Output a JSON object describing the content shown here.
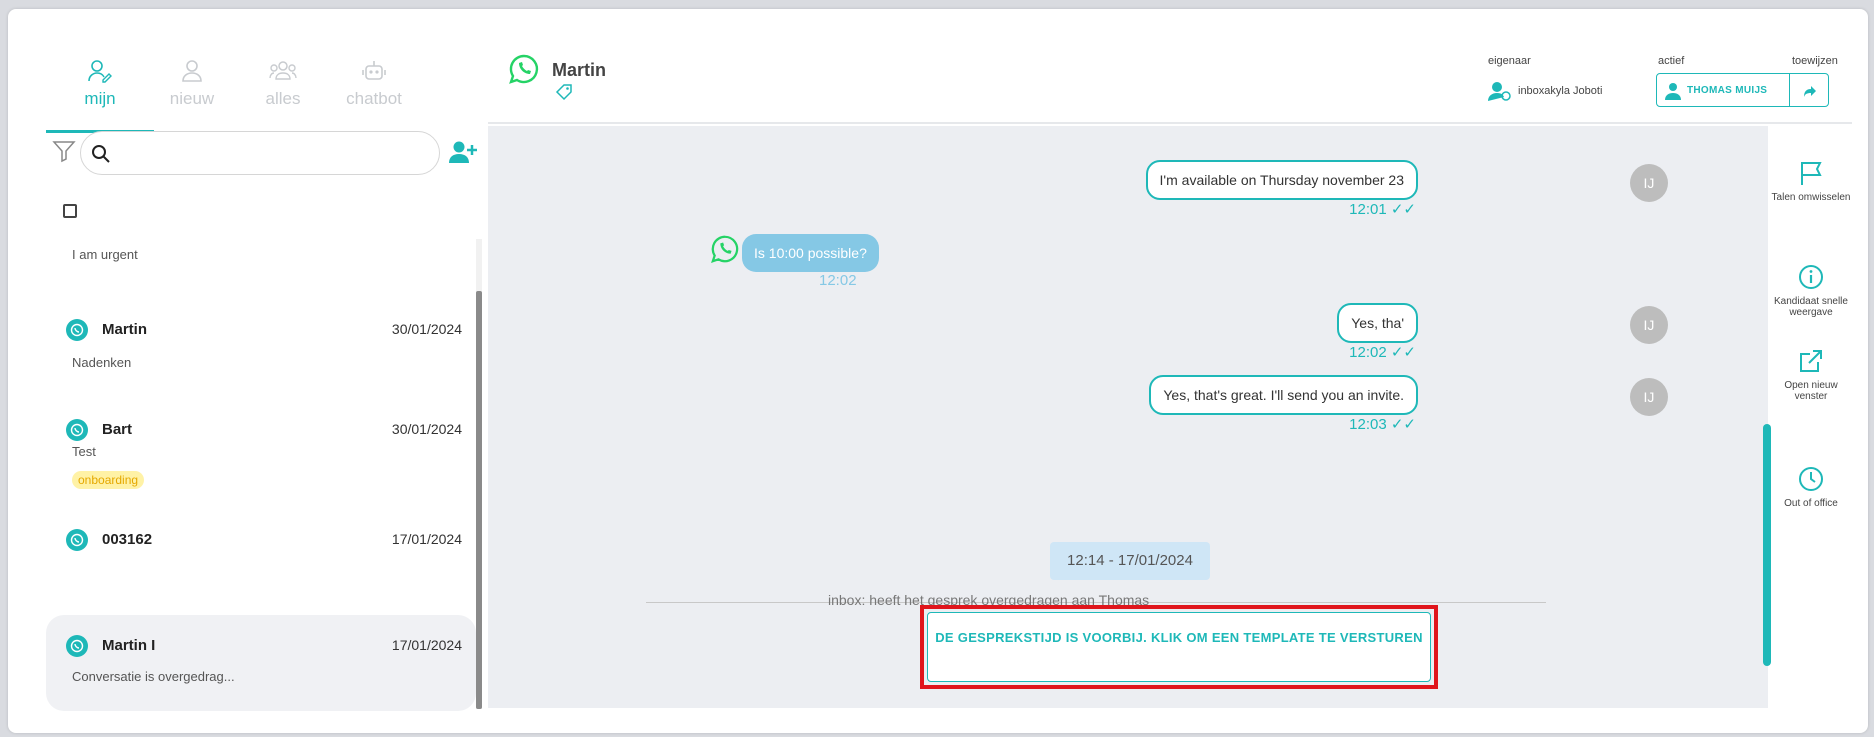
{
  "tabs": [
    {
      "label": "mijn",
      "icon": "user-edit-icon",
      "active": true
    },
    {
      "label": "nieuw",
      "icon": "user-icon",
      "active": false
    },
    {
      "label": "alles",
      "icon": "group-icon",
      "active": false
    },
    {
      "label": "chatbot",
      "icon": "robot-icon",
      "active": false
    }
  ],
  "search": {
    "placeholder": "",
    "value": ""
  },
  "conversations": [
    {
      "name": "",
      "date": "",
      "preview": "I am urgent",
      "tag": ""
    },
    {
      "name": "Martin",
      "date": "30/01/2024",
      "preview": "Nadenken",
      "tag": ""
    },
    {
      "name": "Bart",
      "date": "30/01/2024",
      "preview": "Test",
      "tag": "onboarding"
    },
    {
      "name": "003162",
      "date": "17/01/2024",
      "preview": "",
      "tag": ""
    },
    {
      "name": "Martin I",
      "date": "17/01/2024",
      "preview": "Conversatie is overgedrag...",
      "tag": ""
    }
  ],
  "header": {
    "contact_name": "Martin",
    "owner_label": "eigenaar",
    "owner_name": "inboxakyla Joboti",
    "active_label": "actief",
    "assign_label": "toewijzen",
    "assignee": "THOMAS MUIJS"
  },
  "messages": [
    {
      "direction": "out",
      "text": "I'm available on Thursday november 23",
      "time": "12:01",
      "avatar": "IJ"
    },
    {
      "direction": "in",
      "text": "Is 10:00 possible?",
      "time": "12:02"
    },
    {
      "direction": "out",
      "text": "Yes, tha'",
      "time": "12:02",
      "avatar": "IJ"
    },
    {
      "direction": "out",
      "text": "Yes, that's great. I'll send you an invite.",
      "time": "12:03",
      "avatar": "IJ"
    }
  ],
  "date_chip": "12:14 - 17/01/2024",
  "system_message": "inbox:             heeft het gesprek overgedragen aan Thomas",
  "template_button": "DE GESPREKSTIJD IS VOORBIJ. KLIK OM EEN TEMPLATE TE VERSTUREN",
  "right_bar": [
    {
      "label": "Talen omwisselen",
      "icon": "flag-icon"
    },
    {
      "label": "Kandidaat snelle weergave",
      "icon": "info-icon"
    },
    {
      "label": "Open nieuw venster",
      "icon": "external-link-icon"
    },
    {
      "label": "Out of office",
      "icon": "clock-icon"
    }
  ],
  "colors": {
    "accent": "#1eb8b8",
    "incoming": "#85c8e5",
    "highlight": "#e0151c",
    "whatsapp": "#25d366"
  }
}
